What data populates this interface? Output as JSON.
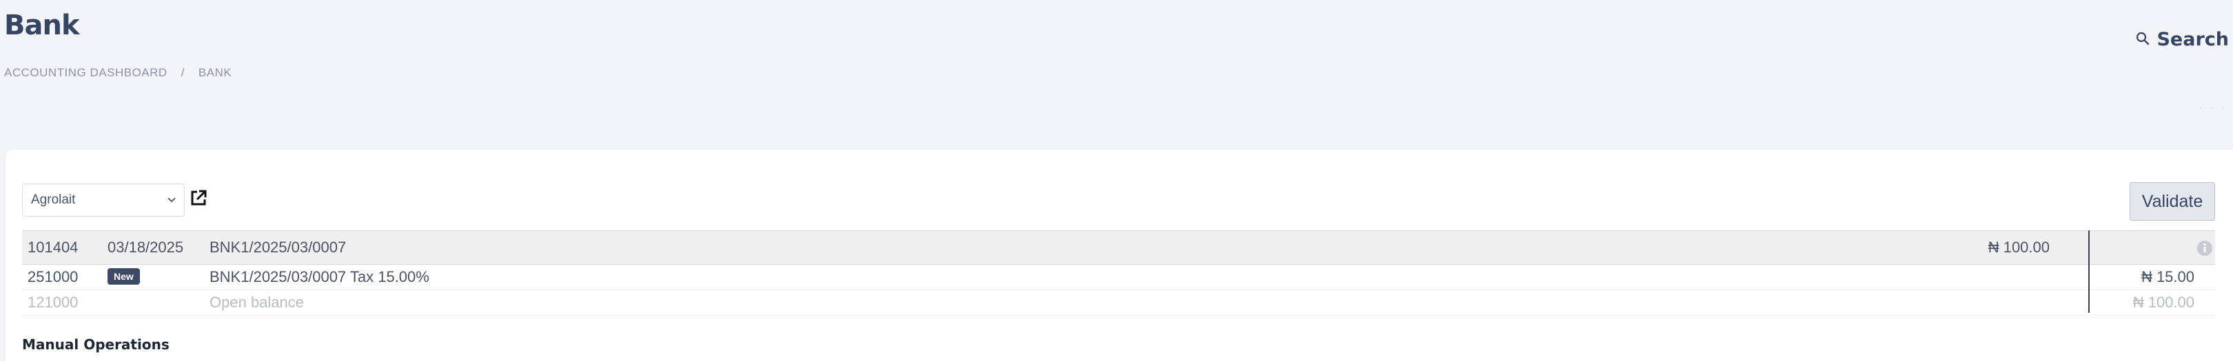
{
  "header": {
    "title": "Bank",
    "breadcrumb": [
      "ACCOUNTING DASHBOARD",
      "BANK"
    ],
    "breadcrumb_sep": "/",
    "search_label": "Search"
  },
  "toolbar": {
    "partner_value": "Agrolait",
    "validate_label": "Validate"
  },
  "lines": [
    {
      "account": "101404",
      "date": "03/18/2025",
      "label": "BNK1/2025/03/0007",
      "debit": "₦ 100.00",
      "credit": ""
    },
    {
      "account": "251000",
      "badge": "New",
      "label": "BNK1/2025/03/0007 Tax 15.00%",
      "debit": "",
      "credit": "₦ 15.00"
    },
    {
      "account": "121000",
      "label": "Open balance",
      "debit": "",
      "credit": "₦ 100.00"
    }
  ],
  "section": {
    "manual_operations": "Manual Operations"
  },
  "icons": {
    "search": "search-icon",
    "external": "external-link-icon",
    "info": "info-icon",
    "dropdown": "chevron-down-icon"
  },
  "colors": {
    "badge_bg": "#3d4a66",
    "title": "#364563",
    "page_bg": "#f3f4f8"
  }
}
